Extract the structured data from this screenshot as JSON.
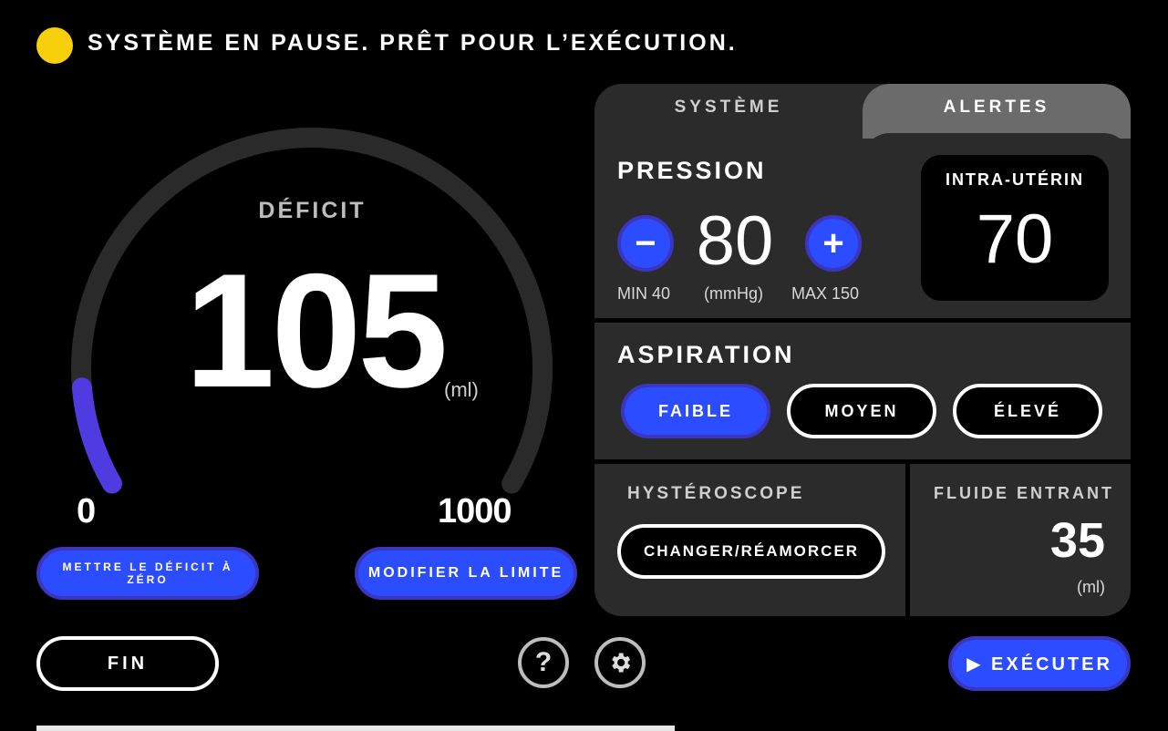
{
  "status": {
    "text": "SYSTÈME EN PAUSE. PRÊT POUR L’EXÉCUTION.",
    "indicator_color": "#f7cf0b"
  },
  "gauge": {
    "title": "DÉFICIT",
    "value": "105",
    "unit": "(ml)",
    "min": "0",
    "max": "1000",
    "progress_fraction": 0.105,
    "track_color": "#2a2a2a",
    "fill_color": "#4f3be0"
  },
  "buttons": {
    "reset_deficit": "METTRE LE DÉFICIT À ZÉRO",
    "modify_limit": "MODIFIER LA LIMITE",
    "end": "FIN",
    "help": "?",
    "run": "▶ EXÉCUTER"
  },
  "panel": {
    "tabs": [
      {
        "label": "SYSTÈME",
        "active": true
      },
      {
        "label": "ALERTES",
        "active": false
      }
    ],
    "pression": {
      "title": "PRESSION",
      "minus": "−",
      "plus": "+",
      "value": "80",
      "min_label": "MIN 40",
      "unit_label": "(mmHg)",
      "max_label": "MAX 150"
    },
    "intra_uterin": {
      "label": "INTRA-UTÉRIN",
      "value": "70"
    },
    "aspiration": {
      "title": "ASPIRATION",
      "options": [
        "FAIBLE",
        "MOYEN",
        "ÉLEVÉ"
      ],
      "selected": "FAIBLE"
    },
    "hysteroscope": {
      "title": "HYSTÉROSCOPE",
      "button": "CHANGER/RÉAMORCER"
    },
    "fluide_entrant": {
      "title": "FLUIDE ENTRANT",
      "value": "35",
      "unit": "(ml)"
    }
  },
  "colors": {
    "accent_blue": "#2c4dff",
    "button_border": "#3b35c0",
    "panel_bg": "#2b2b2b"
  }
}
